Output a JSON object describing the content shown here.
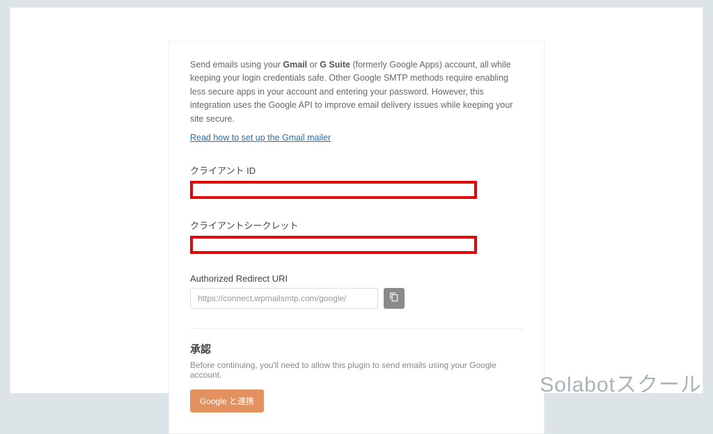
{
  "description": {
    "prefix": "Send emails using your ",
    "b1": "Gmail",
    "mid1": " or ",
    "b2": "G Suite",
    "rest": " (formerly Google Apps) account, all while keeping your login credentials safe. Other Google SMTP methods require enabling less secure apps in your account and entering your password. However, this integration uses the Google API to improve email delivery issues while keeping your site secure."
  },
  "link_text": "Read how to set up the Gmail mailer",
  "fields": {
    "client_id_label": "クライアント ID",
    "client_secret_label": "クライアントシークレット",
    "redirect_label": "Authorized Redirect URI",
    "redirect_value": "https://connect.wpmailsmtp.com/google/"
  },
  "auth": {
    "title": "承認",
    "subtitle": "Before continuing, you'll need to allow this plugin to send emails using your Google account.",
    "button": "Google と連携"
  },
  "watermark": "Solabotスクール"
}
